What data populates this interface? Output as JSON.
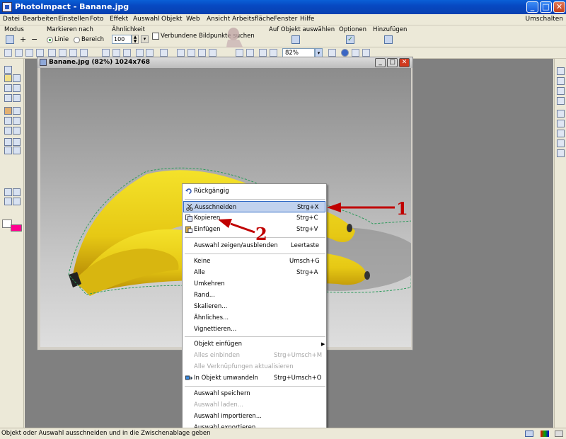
{
  "window": {
    "title": "PhotoImpact - Banane.jpg",
    "controls": [
      "minimize",
      "maximize",
      "close"
    ]
  },
  "menubar": {
    "items": [
      "Datei",
      "Bearbeiten",
      "Einstellen",
      "Foto",
      "Effekt",
      "Auswahl",
      "Objekt",
      "Web",
      "Ansicht",
      "Arbeitsfläche",
      "Fenster",
      "Hilfe"
    ],
    "right": "Umschalten"
  },
  "attribute_toolbar": {
    "modus_label": "Modus",
    "markieren_label": "Markieren nach",
    "radio_linie": "Linie",
    "radio_bereich": "Bereich",
    "selected_radio": "Linie",
    "aehnlichkeit_label": "Ähnlichkeit",
    "aehnlichkeit_value": "100",
    "checkbox_label": "Verbundene Bildpunkte suchen",
    "auf_objekt_label": "Auf Objekt auswählen",
    "optionen_label": "Optionen",
    "hinzufuegen_label": "Hinzufügen"
  },
  "standard_toolbar": {
    "zoom_value": "82%"
  },
  "document": {
    "title": "Banane.jpg (82%) 1024x768"
  },
  "context_menu": {
    "items": [
      {
        "label": "Rückgängig",
        "shortcut": "",
        "icon": "undo-icon",
        "disabled": false,
        "highlighted": false
      },
      {
        "label": "Ausschneiden",
        "shortcut": "Strg+X",
        "icon": "scissors-icon",
        "disabled": false,
        "highlighted": true
      },
      {
        "label": "Kopieren",
        "shortcut": "Strg+C",
        "icon": "copy-icon",
        "disabled": false,
        "highlighted": false
      },
      {
        "label": "Einfügen",
        "shortcut": "Strg+V",
        "icon": "paste-icon",
        "disabled": false,
        "highlighted": false
      },
      {
        "label": "Auswahl zeigen/ausblenden",
        "shortcut": "Leertaste",
        "icon": "",
        "disabled": false,
        "highlighted": false
      },
      {
        "label": "Keine",
        "shortcut": "Umsch+G",
        "icon": "",
        "disabled": false,
        "highlighted": false
      },
      {
        "label": "Alle",
        "shortcut": "Strg+A",
        "icon": "",
        "disabled": false,
        "highlighted": false
      },
      {
        "label": "Umkehren",
        "shortcut": "",
        "icon": "",
        "disabled": false,
        "highlighted": false
      },
      {
        "label": "Rand...",
        "shortcut": "",
        "icon": "",
        "disabled": false,
        "highlighted": false
      },
      {
        "label": "Skalieren...",
        "shortcut": "",
        "icon": "",
        "disabled": false,
        "highlighted": false
      },
      {
        "label": "Ähnliches...",
        "shortcut": "",
        "icon": "",
        "disabled": false,
        "highlighted": false
      },
      {
        "label": "Vignettieren...",
        "shortcut": "",
        "icon": "",
        "disabled": false,
        "highlighted": false
      },
      {
        "label": "Objekt einfügen",
        "shortcut": "",
        "icon": "",
        "disabled": false,
        "highlighted": false,
        "submenu": true
      },
      {
        "label": "Alles einbinden",
        "shortcut": "Strg+Umsch+M",
        "icon": "",
        "disabled": true,
        "highlighted": false
      },
      {
        "label": "Alle Verknüpfungen aktualisieren",
        "shortcut": "",
        "icon": "",
        "disabled": true,
        "highlighted": false
      },
      {
        "label": "In Objekt umwandeln",
        "shortcut": "Strg+Umsch+O",
        "icon": "object-convert-icon",
        "disabled": false,
        "highlighted": false
      },
      {
        "label": "Auswahl speichern",
        "shortcut": "",
        "icon": "",
        "disabled": false,
        "highlighted": false
      },
      {
        "label": "Auswahl laden...",
        "shortcut": "",
        "icon": "",
        "disabled": true,
        "highlighted": false
      },
      {
        "label": "Auswahl importieren...",
        "shortcut": "",
        "icon": "",
        "disabled": false,
        "highlighted": false
      },
      {
        "label": "Auswahl exportieren...",
        "shortcut": "",
        "icon": "",
        "disabled": false,
        "highlighted": false
      }
    ]
  },
  "annotations": {
    "callout_1": "1",
    "callout_2": "2",
    "color": "#c00000"
  },
  "statusbar": {
    "text": "Objekt oder Auswahl ausschneiden und in die Zwischenablage geben"
  },
  "colors": {
    "foreground": "#ffffff",
    "background": "#ff0090",
    "highlight": "#c1d2ee",
    "titlebar": "#0a5fd6"
  }
}
